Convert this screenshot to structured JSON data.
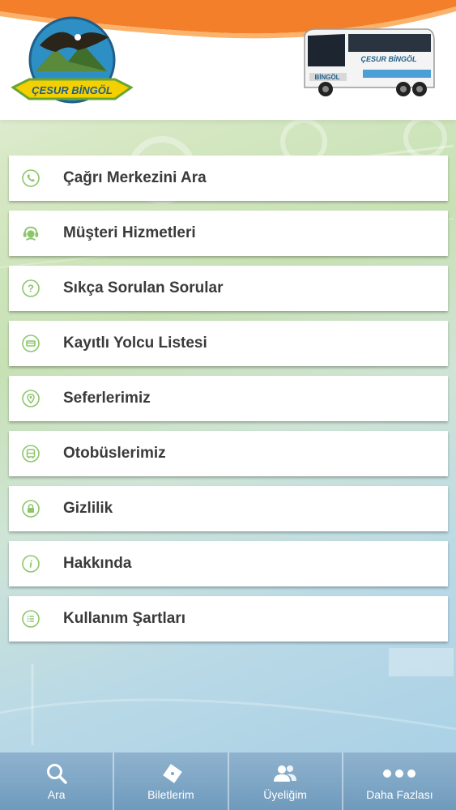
{
  "header": {
    "logo_text": "ÇESUR BİNGÖL",
    "bus_text": "BİNGÖL",
    "bus_brand": "ÇESUR BİNGÖL"
  },
  "menu": {
    "items": [
      {
        "label": "Çağrı Merkezini Ara",
        "icon": "phone-icon"
      },
      {
        "label": "Müşteri Hizmetleri",
        "icon": "customer-service-icon"
      },
      {
        "label": "Sıkça Sorulan Sorular",
        "icon": "question-icon"
      },
      {
        "label": "Kayıtlı Yolcu Listesi",
        "icon": "card-icon"
      },
      {
        "label": "Seferlerimiz",
        "icon": "location-pin-icon"
      },
      {
        "label": "Otobüslerimiz",
        "icon": "bus-icon"
      },
      {
        "label": "Gizlilik",
        "icon": "lock-icon"
      },
      {
        "label": "Hakkında",
        "icon": "info-icon"
      },
      {
        "label": "Kullanım Şartları",
        "icon": "list-icon"
      }
    ]
  },
  "tabbar": {
    "tabs": [
      {
        "label": "Ara",
        "icon": "search-icon"
      },
      {
        "label": "Biletlerim",
        "icon": "ticket-icon"
      },
      {
        "label": "Üyeliğim",
        "icon": "users-icon"
      },
      {
        "label": "Daha Fazlası",
        "icon": "more-icon"
      }
    ]
  },
  "colors": {
    "accent_green": "#8cc66a",
    "header_orange": "#f47f2a",
    "tabbar_blue": "#7fa8c8",
    "label_text": "#3a3a3a"
  }
}
